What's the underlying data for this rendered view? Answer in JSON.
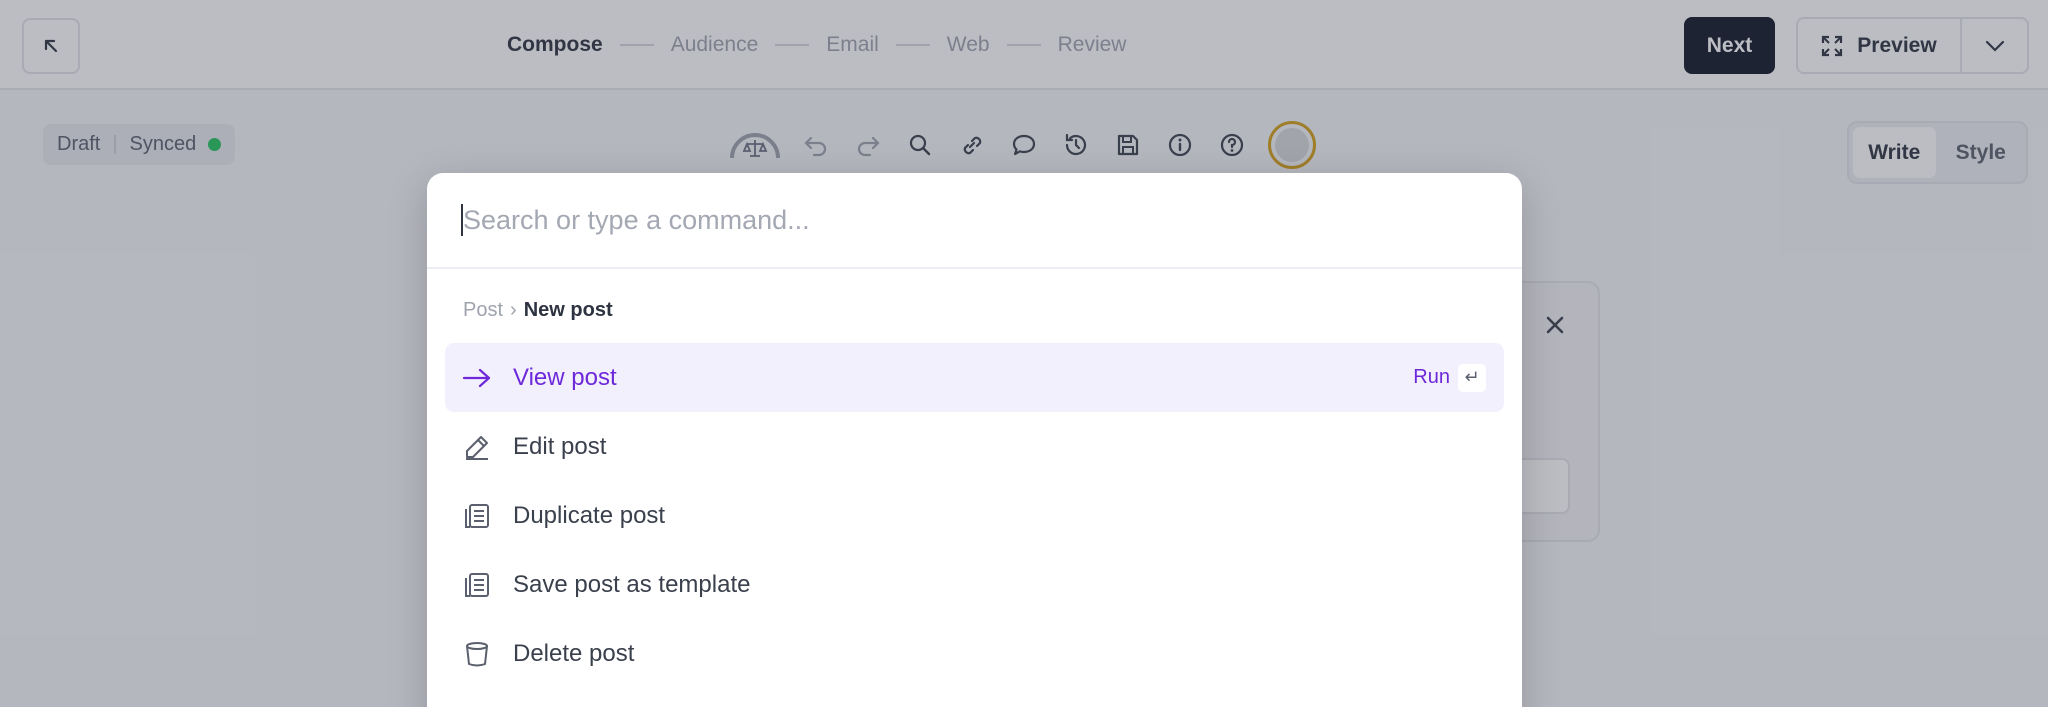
{
  "header": {
    "steps": [
      "Compose",
      "Audience",
      "Email",
      "Web",
      "Review"
    ],
    "active_step": "Compose",
    "next_label": "Next",
    "preview_label": "Preview"
  },
  "status": {
    "draft_label": "Draft",
    "synced_label": "Synced",
    "synced_color": "#22c55e"
  },
  "toolbar": {
    "icons": [
      "compliance-gauge-icon",
      "undo-icon",
      "redo-icon",
      "search-icon",
      "link-icon",
      "comment-icon",
      "history-icon",
      "save-icon",
      "info-icon",
      "help-icon",
      "avatar"
    ]
  },
  "mode_toggle": {
    "write_label": "Write",
    "style_label": "Style",
    "active": "Write"
  },
  "palette": {
    "search_placeholder": "Search or type a command...",
    "breadcrumb_root": "Post",
    "breadcrumb_separator": "›",
    "breadcrumb_current": "New post",
    "commands": [
      {
        "label": "View post",
        "icon": "arrow-right-icon",
        "selected": true
      },
      {
        "label": "Edit post",
        "icon": "pencil-icon",
        "selected": false
      },
      {
        "label": "Duplicate post",
        "icon": "document-stack-icon",
        "selected": false
      },
      {
        "label": "Save post as template",
        "icon": "document-stack-icon",
        "selected": false
      },
      {
        "label": "Delete post",
        "icon": "trash-icon",
        "selected": false
      }
    ],
    "run_label": "Run",
    "run_key": "↵",
    "accent_color": "#6d28d9"
  }
}
